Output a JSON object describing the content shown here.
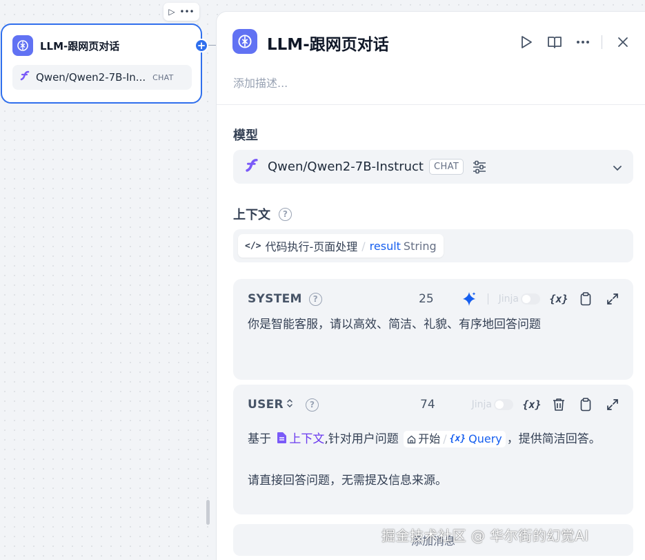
{
  "canvas": {
    "node_toolbar": {
      "run_icon": "play-icon",
      "more_icon": "more-icon"
    },
    "node": {
      "title": "LLM-跟网页对话",
      "icon": "llm-brain-icon",
      "model_name": "Qwen/Qwen2-7B-In...",
      "model_tag": "CHAT",
      "accent": "#2f6fed"
    }
  },
  "panel": {
    "title": "LLM-跟网页对话",
    "description_placeholder": "添加描述...",
    "actions": [
      "play-icon",
      "book-icon",
      "more-icon",
      "close-icon"
    ],
    "model_section": {
      "label": "模型",
      "model_name": "Qwen/Qwen2-7B-Instruct",
      "model_tag": "CHAT"
    },
    "context_section": {
      "label": "上下文",
      "variable": {
        "node": "代码执行-页面处理",
        "name": "result",
        "type": "String"
      }
    },
    "system_prompt": {
      "role": "SYSTEM",
      "count": "25",
      "jinja_label": "Jinja",
      "text": "你是智能客服，请以高效、简洁、礼貌、有序地回答问题"
    },
    "user_prompt": {
      "role": "USER",
      "count": "74",
      "jinja_label": "Jinja",
      "text_before": "基于",
      "context_ref": "上下文",
      "text_middle": ",针对用户问题",
      "query_ref": {
        "node": "开始",
        "name": "Query"
      },
      "text_after": "，提供简洁回答。",
      "text_line2": "请直接回答问题，无需提及信息来源。"
    },
    "add_message_label": "添加消息"
  },
  "watermark": "掘金技术社区 @ 华尔街的幻觉AI",
  "colors": {
    "accent_blue": "#155eef",
    "llm_icon_bg": "#6172f3",
    "context_purple": "#6938ef"
  }
}
